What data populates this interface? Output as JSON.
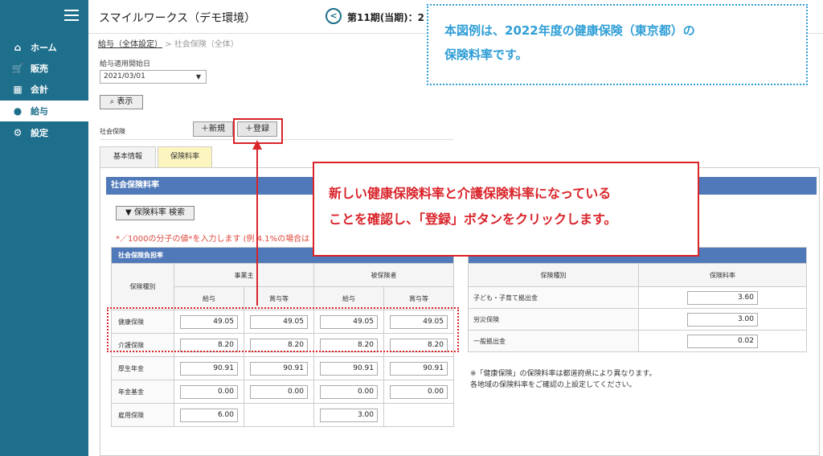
{
  "sidebar": {
    "items": [
      {
        "icon": "home-icon",
        "label": "ホーム"
      },
      {
        "icon": "cart-icon",
        "label": "販売"
      },
      {
        "icon": "calculator-icon",
        "label": "会計"
      },
      {
        "icon": "moneybag-icon",
        "label": "給与",
        "active": true
      },
      {
        "icon": "gear-icon",
        "label": "設定"
      }
    ]
  },
  "header": {
    "title": "スマイルワークス（デモ環境）",
    "period": "第11期(当期)：2"
  },
  "breadcrumb": {
    "link": "給与（全体設定）",
    "current": "> 社会保険（全体）"
  },
  "form": {
    "date_label": "給与適用開始日",
    "date_value": "2021/03/01",
    "show_label": "表示",
    "insurance_label": "社会保険",
    "new_label": "新規",
    "register_label": "登録"
  },
  "tabs": [
    {
      "label": "基本情報"
    },
    {
      "label": "保険料率",
      "active": true
    }
  ],
  "panel": {
    "title": "社会保険料率",
    "search_label": "保険料率 検索",
    "note": "*／1000の分子の値*を入力します (例 4.1%の場合は"
  },
  "left_table": {
    "title": "社会保険負担率",
    "col_type": "保険種別",
    "group_employer": "事業主",
    "group_insured": "被保険者",
    "sub_salary": "給与",
    "sub_bonus": "賞与等",
    "rows": [
      {
        "label": "健康保険",
        "values": [
          "49.05",
          "49.05",
          "49.05",
          "49.05"
        ]
      },
      {
        "label": "介護保険",
        "values": [
          "8.20",
          "8.20",
          "8.20",
          "8.20"
        ]
      },
      {
        "label": "厚生年金",
        "values": [
          "90.91",
          "90.91",
          "90.91",
          "90.91"
        ]
      },
      {
        "label": "年金基金",
        "values": [
          "0.00",
          "0.00",
          "0.00",
          "0.00"
        ]
      },
      {
        "label": "雇用保険",
        "values": [
          "6.00",
          "",
          "3.00",
          ""
        ]
      }
    ]
  },
  "right_table": {
    "col_type": "保険種別",
    "col_rate": "保険料率",
    "rows": [
      {
        "label": "子ども・子育て拠出金",
        "value": "3.60"
      },
      {
        "label": "労災保険",
        "value": "3.00"
      },
      {
        "label": "一般拠出金",
        "value": "0.02"
      }
    ],
    "note_1": "※「健康保険」の保険料率は都道府県により異なります。",
    "note_2": "各地域の保険料率をご確認の上設定してください。"
  },
  "callouts": {
    "top_line1": "本図例は、2022年度の健康保険（東京都）の",
    "top_line2": "保険料率です。",
    "main_line1": "新しい健康保険料率と介護保険料率になっている",
    "main_line2": "ことを確認し、「登録」ボタンをクリックします。"
  },
  "colors": {
    "sidebar": "#1e6f8c",
    "panel_header": "#5079b9",
    "callout_red": "#d9242a",
    "callout_blue": "#2f9ed6",
    "tab_active": "#fdf5c0"
  }
}
